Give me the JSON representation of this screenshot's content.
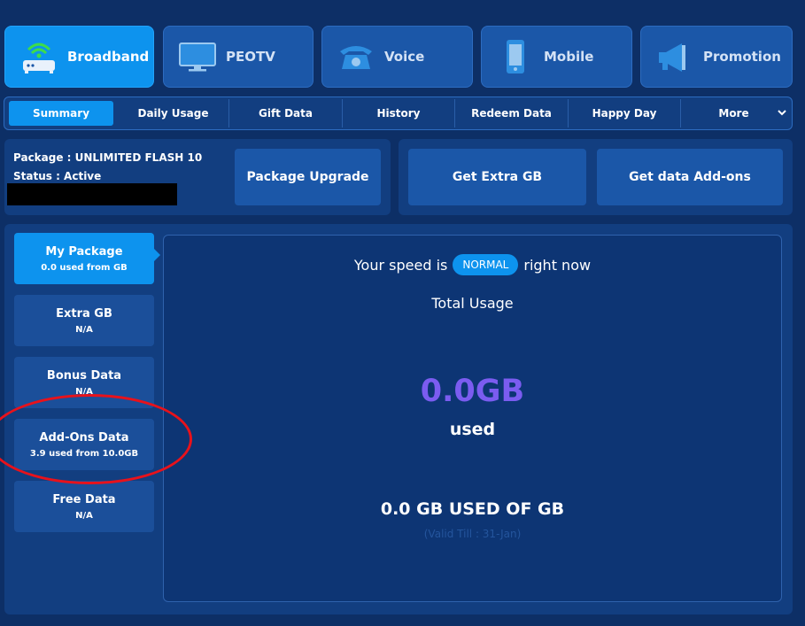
{
  "service_tabs": [
    {
      "label": "Broadband",
      "icon": "router-wifi-icon"
    },
    {
      "label": "PEOTV",
      "icon": "tv-icon"
    },
    {
      "label": "Voice",
      "icon": "telephone-icon"
    },
    {
      "label": "Mobile",
      "icon": "mobile-phone-icon"
    },
    {
      "label": "Promotion",
      "icon": "megaphone-icon"
    }
  ],
  "subnav": {
    "items": [
      "Summary",
      "Daily Usage",
      "Gift Data",
      "History",
      "Redeem Data",
      "Happy Day",
      "More"
    ],
    "active": "Summary",
    "more_icon": "chevron-down-icon"
  },
  "package": {
    "name_line": "Package : UNLIMITED FLASH 10",
    "status_line": "Status : Active",
    "upgrade_label": "Package Upgrade"
  },
  "actions": {
    "extra_gb_label": "Get Extra GB",
    "addons_label": "Get data Add-ons"
  },
  "side_cards": [
    {
      "title": "My Package",
      "sub": "0.0 used from GB"
    },
    {
      "title": "Extra GB",
      "sub": "N/A"
    },
    {
      "title": "Bonus Data",
      "sub": "N/A"
    },
    {
      "title": "Add-Ons Data",
      "sub": "3.9 used from 10.0GB"
    },
    {
      "title": "Free Data",
      "sub": "N/A"
    }
  ],
  "usage": {
    "speed_prefix": "Your speed is",
    "speed_badge": "NORMAL",
    "speed_suffix": "right now",
    "total_label": "Total Usage",
    "amount": "0.0GB",
    "used_label": "used",
    "summary": "0.0 GB USED OF GB",
    "valid_till": "(Valid Till : 31-Jan)"
  },
  "colors": {
    "background": "#0d2f66",
    "accent": "#0d93ee",
    "amount": "#7b5cf0",
    "highlight_circle": "#e8121b"
  }
}
